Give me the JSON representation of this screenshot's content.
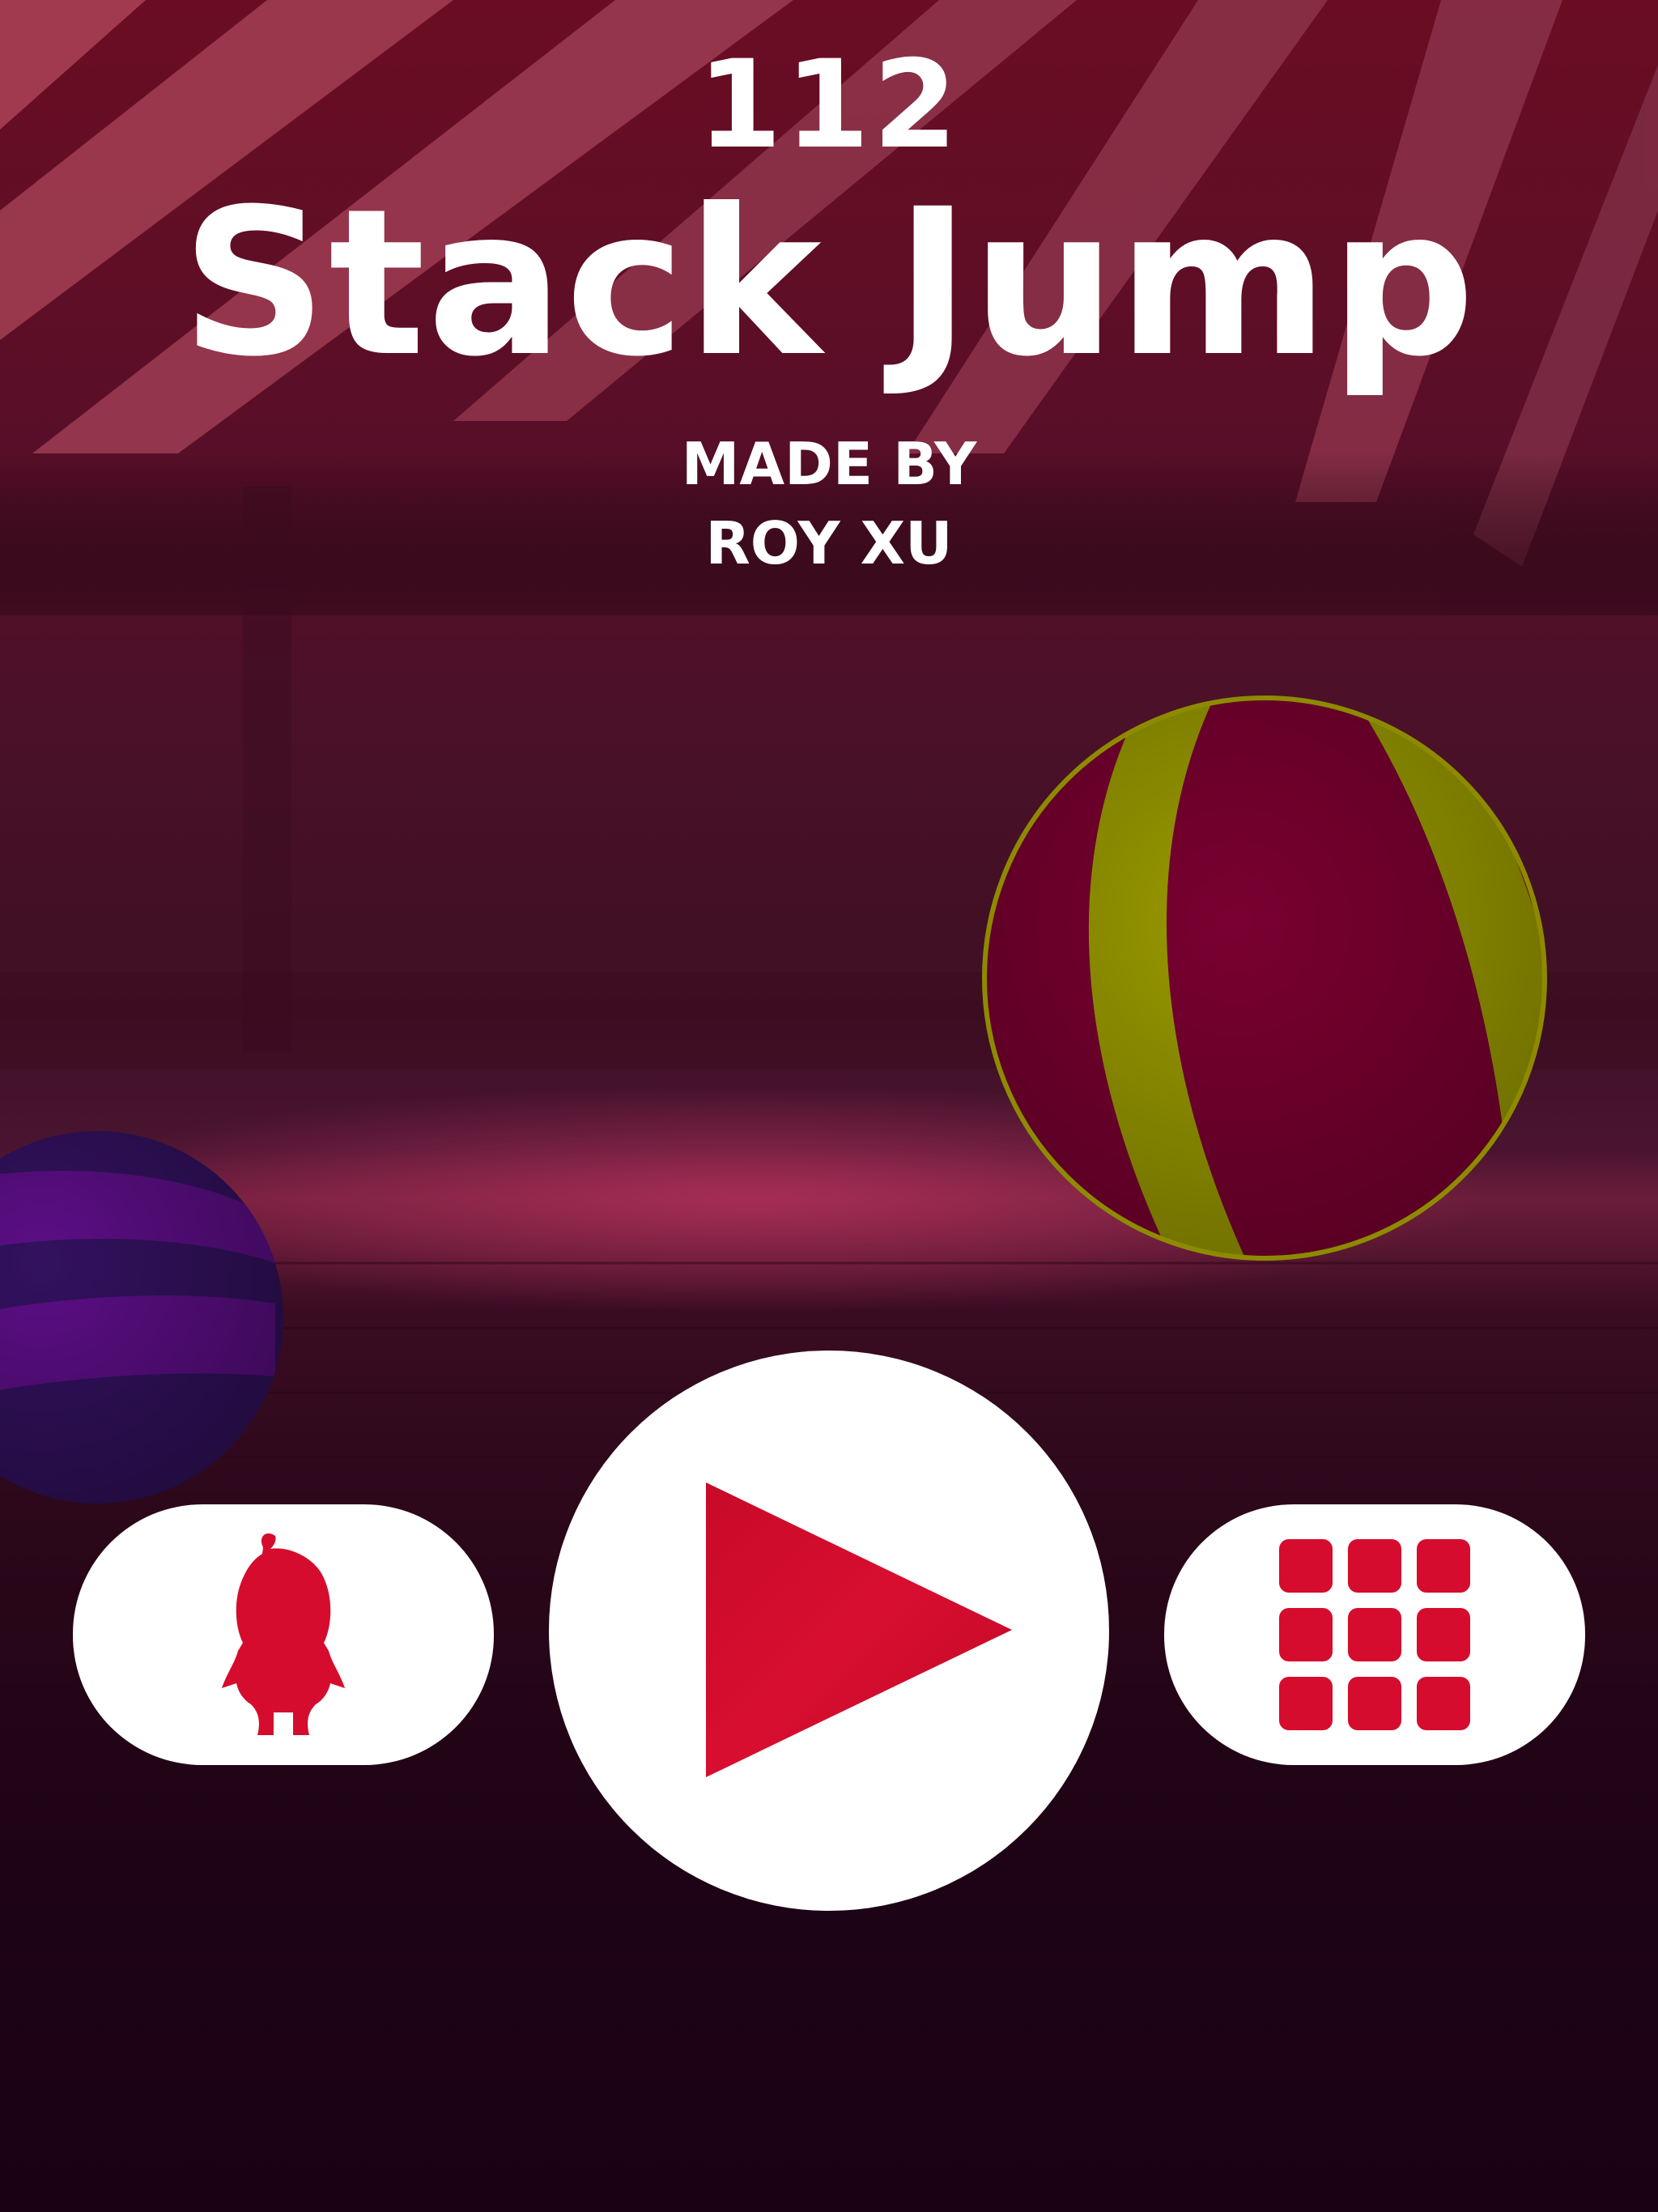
{
  "game": {
    "score": "112",
    "title": "Stack Jump",
    "credit_line1": "MADE BY",
    "credit_line2": "ROY XU"
  },
  "buttons": {
    "character": {
      "icon": "character-silhouette-icon"
    },
    "play": {
      "icon": "play-triangle-icon"
    },
    "levels": {
      "icon": "grid-icon",
      "grid_cells": 9
    }
  },
  "colors": {
    "accent": "#d60c2e",
    "button_bg": "#ffffff",
    "text": "#ffffff",
    "tent_red": "#8a0f24",
    "tent_stripe": "#a8455a",
    "ball_yellow": "#9a9a00",
    "ball_magenta": "#7a0030",
    "ball_purple": "#5c0e86",
    "ball_violet": "#33115f"
  }
}
